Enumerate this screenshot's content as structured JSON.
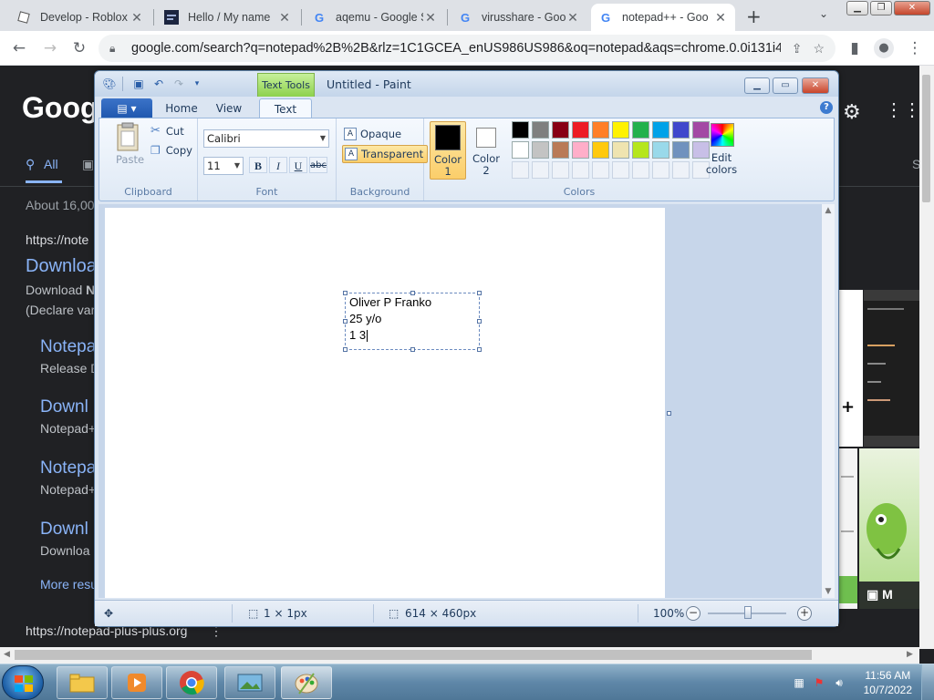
{
  "browser": {
    "tabs": [
      {
        "title": "Develop - Roblox",
        "icon": "roblox-icon"
      },
      {
        "title": "Hello / My name",
        "icon": "blog-icon"
      },
      {
        "title": "aqemu - Google S",
        "icon": "google-icon"
      },
      {
        "title": "virusshare - Goog",
        "icon": "google-icon"
      },
      {
        "title": "notepad++ - Goo",
        "icon": "google-icon",
        "active": true
      }
    ],
    "new_tab": "+",
    "url": "google.com/search?q=notepad%2B%2B&rlz=1C1GCEA_enUS986US986&oq=notepad&aqs=chrome.0.0i131i433..."
  },
  "google": {
    "logo": "Googl",
    "nav_all": "All",
    "about": "About 16,00",
    "result_url": "https://note",
    "result1_title": "Downloa",
    "result1_line1_a": "Download ",
    "result1_line1_b": "N",
    "result1_line2": "(Declare var",
    "sub1_title": "Notepa",
    "sub1_desc": "Release D",
    "sub2_title": "Downl",
    "sub2_desc": "Notepad+",
    "sub3_title": "Notepa",
    "sub3_desc": "Notepad+",
    "sub4_title": "Downl",
    "sub4_desc": "Downloa",
    "more": "More resu",
    "bottom_url": "https://notepad-plus-plus.org",
    "right_s": "S",
    "thumb_label": "M"
  },
  "paint": {
    "title": "Untitled - Paint",
    "context_tab": "Text Tools",
    "tabs": {
      "home": "Home",
      "view": "View",
      "text": "Text"
    },
    "clipboard": {
      "paste": "Paste",
      "cut": "Cut",
      "copy": "Copy",
      "group": "Clipboard"
    },
    "font": {
      "family": "Calibri",
      "size": "11",
      "bold": "B",
      "italic": "I",
      "underline": "U",
      "strike": "abc",
      "group": "Font"
    },
    "background": {
      "opaque": "Opaque",
      "transparent": "Transparent",
      "group": "Background"
    },
    "colors": {
      "color1": "Color 1",
      "color2": "Color 2",
      "edit": "Edit colors",
      "group": "Colors",
      "color1_value": "#000000",
      "color2_value": "#ffffff",
      "palette_row1": [
        "#000000",
        "#7f7f7f",
        "#880015",
        "#ed1c24",
        "#ff7f27",
        "#fff200",
        "#22b14c",
        "#00a2e8",
        "#3f48cc",
        "#a349a4"
      ],
      "palette_row2": [
        "#ffffff",
        "#c3c3c3",
        "#b97a57",
        "#ffaec9",
        "#ffc90e",
        "#efe4b0",
        "#b5e61d",
        "#99d9ea",
        "#7092be",
        "#c8bfe7"
      ]
    },
    "text_lines": [
      "Oliver P Franko",
      "25 y/o",
      "1 3"
    ],
    "status": {
      "cursor_size": "1 × 1px",
      "canvas_size": "614 × 460px",
      "zoom": "100%"
    }
  },
  "taskbar": {
    "time": "11:56 AM",
    "date": "10/7/2022"
  }
}
